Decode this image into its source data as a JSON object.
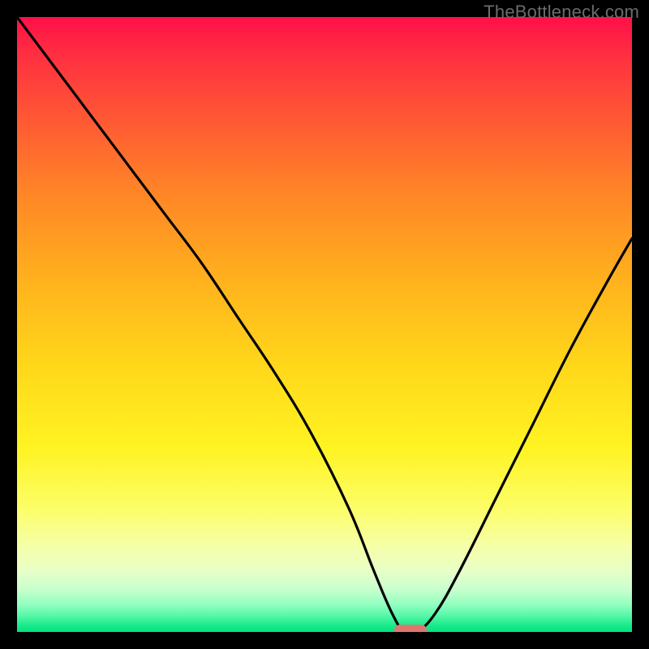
{
  "watermark": "TheBottleneck.com",
  "chart_data": {
    "type": "line",
    "title": "",
    "xlabel": "",
    "ylabel": "",
    "xlim": [
      0,
      100
    ],
    "ylim": [
      0,
      100
    ],
    "x": [
      0,
      6,
      12,
      18,
      24,
      30,
      36,
      42,
      48,
      54,
      58,
      61,
      63,
      65,
      68,
      72,
      78,
      84,
      90,
      96,
      100
    ],
    "values": [
      100,
      92,
      84,
      76,
      68,
      60,
      51,
      42,
      32,
      20,
      10,
      3,
      0,
      0,
      3,
      10,
      22,
      34,
      46,
      57,
      64
    ],
    "marker_x": 64,
    "marker_y": 0,
    "gradient_colors": {
      "top": "#ff1047",
      "mid_upper": "#ffb21d",
      "mid": "#fff322",
      "mid_lower": "#f6ffa8",
      "bottom": "#00e37f"
    },
    "line_color": "#000000",
    "marker_color": "#e2766f",
    "frame_color": "#000000"
  }
}
